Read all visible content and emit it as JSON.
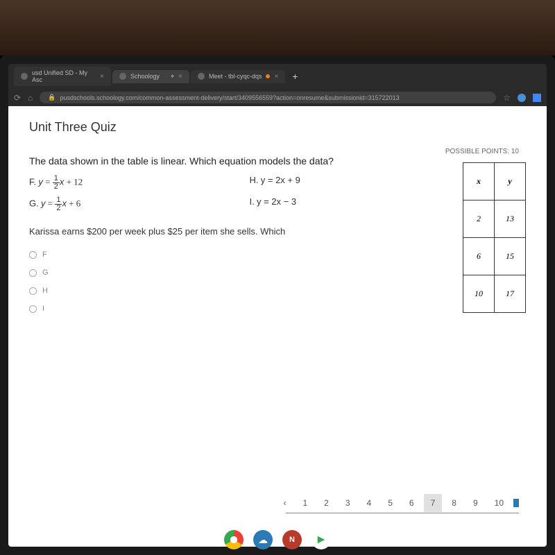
{
  "tabs": [
    {
      "label": "usd Unified SD - My Asc",
      "active": false
    },
    {
      "label": "Schoology",
      "active": true
    },
    {
      "label": "Meet - tbl-cyqc-dqs",
      "active": false
    }
  ],
  "url": "pusdschools.schoology.com/common-assessment-delivery/start/3409556559?action=onresume&submissionid=315722013",
  "quiz_title": "Unit Three Quiz",
  "possible_points": "POSSIBLE POINTS: 10",
  "question": "The data shown in the table is linear. Which equation models the data?",
  "options": {
    "F": {
      "prefix": "F.",
      "text": "x + 12",
      "has_frac": true
    },
    "G": {
      "prefix": "G.",
      "text": "x + 6",
      "has_frac": true
    },
    "H": {
      "prefix": "H.",
      "text": "y = 2x + 9"
    },
    "I": {
      "prefix": "I.",
      "text": "y = 2x − 3"
    }
  },
  "table": {
    "headers": [
      "x",
      "y"
    ],
    "rows": [
      [
        "2",
        "13"
      ],
      [
        "6",
        "15"
      ],
      [
        "10",
        "17"
      ]
    ]
  },
  "second_q": "Karissa earns $200 per week plus $25 per item she sells. Which",
  "radio_labels": [
    "F",
    "G",
    "H",
    "I"
  ],
  "pagination": {
    "prev": "‹",
    "pages": [
      "1",
      "2",
      "3",
      "4",
      "5",
      "6",
      "7",
      "8",
      "9",
      "10"
    ],
    "current": 7
  },
  "chart_data": {
    "type": "table",
    "columns": [
      "x",
      "y"
    ],
    "rows": [
      [
        2,
        13
      ],
      [
        6,
        15
      ],
      [
        10,
        17
      ]
    ]
  }
}
